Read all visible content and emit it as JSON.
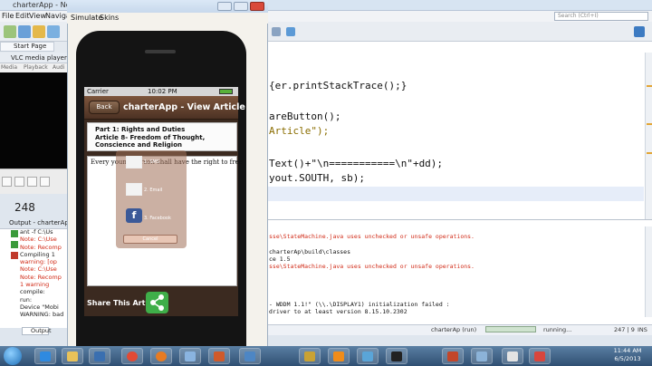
{
  "netbeans": {
    "title": "charterApp - NetBea",
    "menu": [
      "File",
      "Edit",
      "View",
      "Navigat"
    ],
    "search_placeholder": "Search (Ctrl+I)",
    "start_tab": "Start Page"
  },
  "vlc": {
    "title": "VLC media player",
    "menu": [
      "Media",
      "Playback",
      "Audi"
    ],
    "counter": "248"
  },
  "output_left": {
    "title": "Output - charterAp",
    "lines": [
      "ant -f C:\\Us",
      "Note: C:\\Use",
      "Note: Recomp",
      "Compiling 1",
      "warning: [op",
      "Note: C:\\Use",
      "Note: Recomp",
      "1 warning",
      "compile:",
      "run:",
      "Device \"Mobi",
      "WARNING: bad"
    ],
    "tab_label": "Output"
  },
  "editor": {
    "lines": [
      "{er.printStackTrace();}",
      "areButton();",
      "Article\");",
      "Text()+\"\\n===========\\n\"+dd);",
      "yout.SOUTH, sb);"
    ]
  },
  "build_output": {
    "lines": [
      {
        "text": "sse\\StateMachine.java uses unchecked or unsafe operations.",
        "kind": "err"
      },
      {
        "text": "charterAp\\build\\classes",
        "kind": "normal"
      },
      {
        "text": "ce 1.5",
        "kind": "normal"
      },
      {
        "text": "sse\\StateMachine.java uses unchecked or unsafe operations.",
        "kind": "err"
      },
      {
        "text": "- WDDM 1.1!\" (\\\\.\\DISPLAY1) initialization failed :",
        "kind": "normal"
      },
      {
        "text": "driver to at least version 8.15.10.2302",
        "kind": "normal"
      }
    ]
  },
  "statusbar": {
    "run": "charterAp (run)",
    "running": "running...",
    "position": "247 | 9",
    "mode": "INS"
  },
  "simulator": {
    "menu": [
      "Simulate",
      "Skins"
    ],
    "carrier": "Carrier",
    "time": "10:02 PM",
    "back_label": "Back",
    "nav_title": "charterApp - View Article",
    "article_part": "Part 1: Rights and Duties",
    "article_title": "Article 8- Freedom of Thought, Conscience and Religion",
    "article_title_line1": "Article 8- Freedom of Thought,",
    "article_title_line2": "Conscience and Religion",
    "article_text": "Every young person shall have the right to free",
    "share": {
      "sms_label": "1. SMS",
      "email_label": "2. Email",
      "facebook_label": "3. Facebook",
      "cancel_label": "Cancel"
    },
    "share_label": "Share This Article"
  },
  "taskbar": {
    "time": "11:44 AM",
    "date": "6/5/2013"
  },
  "colors": {
    "nav_brown": "#5a3b2a",
    "share_green": "#3fae49",
    "error_red": "#d12a16"
  }
}
